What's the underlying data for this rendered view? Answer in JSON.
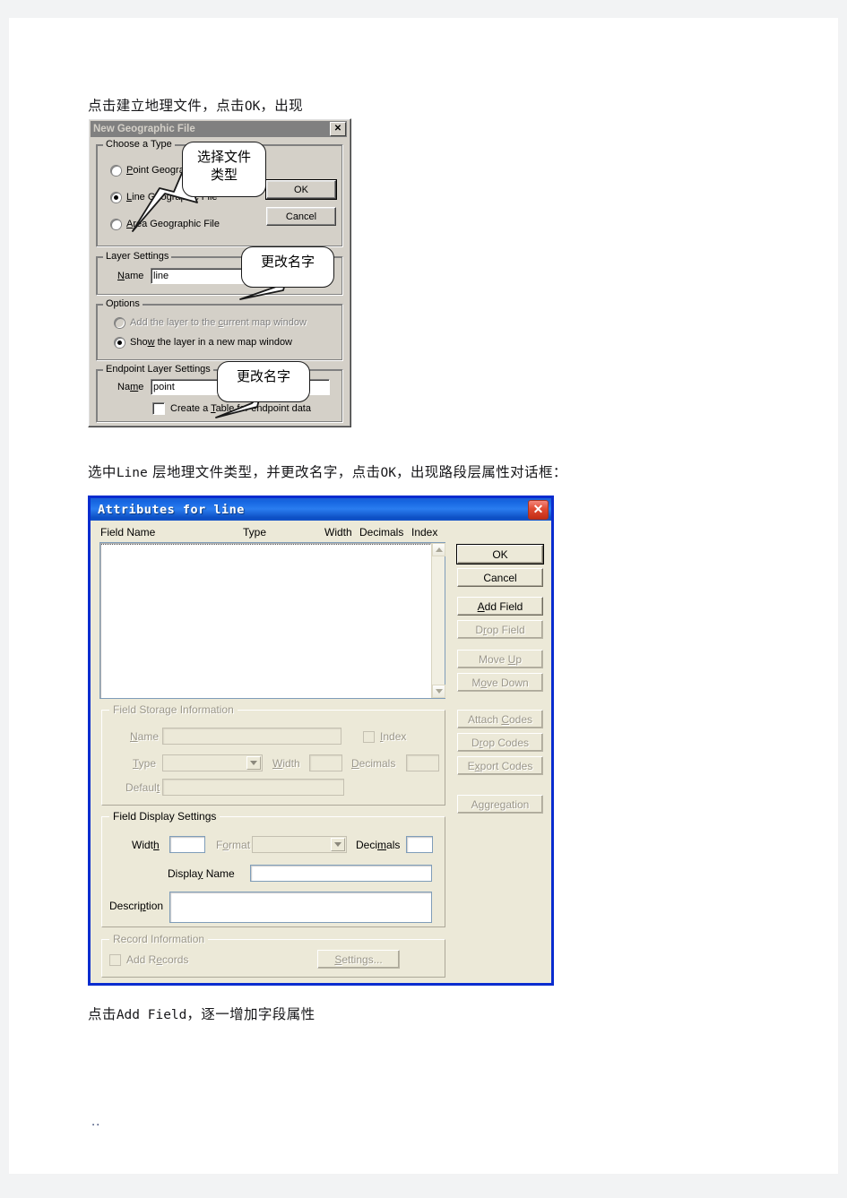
{
  "paragraphs": {
    "p1_pre": "点击建立地理文件，点击",
    "p1_ok": "OK",
    "p1_post": "，出现",
    "p2_pre": "选中",
    "p2_line": "Line",
    "p2_mid": " 层地理文件类型，并更改名字，点击",
    "p2_ok": "OK",
    "p2_post": "，出现路段层属性对话框：",
    "p3_pre": "点击",
    "p3_cmd": "Add Field",
    "p3_post": "，逐一增加字段属性",
    "footer_mark": ".."
  },
  "new_geo_dialog": {
    "title": "New Geographic File",
    "close_label": "✕",
    "choose_type": {
      "legend": "Choose a Type",
      "options": [
        {
          "label_u": "P",
          "label_rest": "oint Geographic File",
          "selected": false,
          "disabled": false
        },
        {
          "label_u": "L",
          "label_rest": "ine Geographic File",
          "selected": true,
          "disabled": false
        },
        {
          "label_u": "A",
          "label_rest": "rea Geographic File",
          "selected": false,
          "disabled": false
        }
      ]
    },
    "buttons": {
      "ok": "OK",
      "cancel": "Cancel"
    },
    "layer_settings": {
      "legend": "Layer Settings",
      "name_label_u": "N",
      "name_label_rest": "ame",
      "name_value": "line"
    },
    "options": {
      "legend": "Options",
      "opt1_pre": "Add the layer to the ",
      "opt1_u": "c",
      "opt1_post": "urrent map window",
      "opt1_selected": false,
      "opt1_disabled": true,
      "opt2_pre": "Sho",
      "opt2_u": "w",
      "opt2_post": " the layer in a new map window",
      "opt2_selected": true,
      "opt2_disabled": false
    },
    "endpoint_settings": {
      "legend": "Endpoint Layer Settings",
      "name_label_pre": "Na",
      "name_label_u": "m",
      "name_label_post": "e",
      "name_value": "point",
      "checkbox_pre": "Create a ",
      "checkbox_u": "T",
      "checkbox_post": "able for endpoint data",
      "checkbox_checked": false
    }
  },
  "callouts": [
    {
      "text": "选择文件\n类型"
    },
    {
      "text": "更改名字"
    },
    {
      "text": "更改名字"
    }
  ],
  "attributes_dialog": {
    "title": "Attributes for line",
    "close_label": "✕",
    "columns": [
      {
        "label": "Field Name"
      },
      {
        "label": "Type"
      },
      {
        "label": "Width"
      },
      {
        "label": "Decimals"
      },
      {
        "label": "Index"
      }
    ],
    "list_items": [],
    "side_buttons": [
      {
        "label": "OK",
        "disabled": false,
        "default": true
      },
      {
        "label": "Cancel",
        "disabled": false,
        "default": false
      },
      {
        "label_u": "A",
        "label_rest": "dd Field",
        "disabled": false,
        "default": false
      },
      {
        "label_pre": "D",
        "label_u": "r",
        "label_post": "op Field",
        "disabled": true,
        "default": false
      },
      {
        "label_pre": "Move ",
        "label_u": "U",
        "label_post": "p",
        "disabled": true,
        "default": false
      },
      {
        "label_pre": "M",
        "label_u": "o",
        "label_post": "ve Down",
        "disabled": true,
        "default": false
      },
      {
        "label_pre": "Attach ",
        "label_u": "C",
        "label_post": "odes",
        "disabled": true,
        "default": false
      },
      {
        "label_pre": "D",
        "label_u": "r",
        "label_post": "op Codes",
        "disabled": true,
        "default": false
      },
      {
        "label_pre": "E",
        "label_u": "x",
        "label_post": "port Codes",
        "disabled": true,
        "default": false
      },
      {
        "label_pre": "Aggregation",
        "label_u": "",
        "label_post": "",
        "disabled": true,
        "default": false
      }
    ],
    "field_storage": {
      "legend": "Field Storage Information",
      "name_label_u": "N",
      "name_label_rest": "ame",
      "name_value": "",
      "index_label_u": "I",
      "index_label_rest": "ndex",
      "index_checked": false,
      "type_label_u": "T",
      "type_label_rest": "ype",
      "type_value": "",
      "width_label_pre": "",
      "width_label_u": "W",
      "width_label_post": "idth",
      "width_value": "",
      "decimals_label_pre": "",
      "decimals_label_u": "D",
      "decimals_label_post": "ecimals",
      "decimals_value": "",
      "default_label_pre": "Defaul",
      "default_label_u": "t",
      "default_value": ""
    },
    "field_display": {
      "legend": "Field Display Settings",
      "width_label_pre": "Widt",
      "width_label_u": "h",
      "width_value": "",
      "format_label_pre": "F",
      "format_label_u": "o",
      "format_label_post": "rmat",
      "format_value": "",
      "decimals_label_pre": "Deci",
      "decimals_label_u": "m",
      "decimals_label_post": "als",
      "decimals_value": "",
      "display_name_label_pre": "Displa",
      "display_name_label_u": "y",
      "display_name_label_post": " Name",
      "display_name_value": "",
      "description_label_pre": "Descri",
      "description_label_u": "p",
      "description_label_post": "tion",
      "description_value": ""
    },
    "record_information": {
      "legend": "Record Information",
      "add_records_pre": "Add R",
      "add_records_u": "e",
      "add_records_post": "cords",
      "add_records_checked": false,
      "settings_label_pre": "",
      "settings_label_u": "S",
      "settings_label_post": "ettings..."
    }
  }
}
